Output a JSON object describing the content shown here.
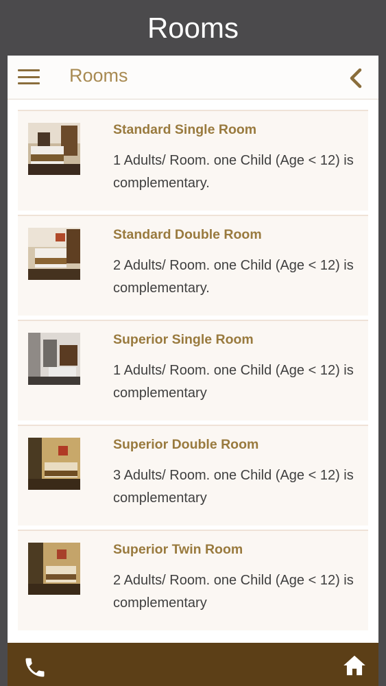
{
  "window": {
    "title": "Rooms"
  },
  "appbar": {
    "title": "Rooms",
    "menu_icon": "hamburger-menu-icon",
    "back_icon": "chevron-left-icon"
  },
  "rooms": [
    {
      "name": "Standard Single Room",
      "description": "1 Adults/ Room. one Child (Age < 12) is complementary."
    },
    {
      "name": "Standard Double Room",
      "description": "2 Adults/ Room. one Child (Age < 12) is complementary."
    },
    {
      "name": "Superior Single Room",
      "description": "1 Adults/ Room. one Child (Age < 12) is complementary"
    },
    {
      "name": "Superior Double Room",
      "description": "3 Adults/ Room. one Child (Age < 12) is complementary"
    },
    {
      "name": "Superior Twin Room",
      "description": "2 Adults/ Room. one Child (Age < 12) is complementary"
    }
  ],
  "bottom_bar": {
    "left_icon": "phone-icon",
    "right_icon": "home-icon"
  },
  "colors": {
    "background": "#4b4a4c",
    "accent": "#a88a52",
    "card_bg": "#fbf7f3",
    "bottom_bar": "#5c3f17"
  }
}
